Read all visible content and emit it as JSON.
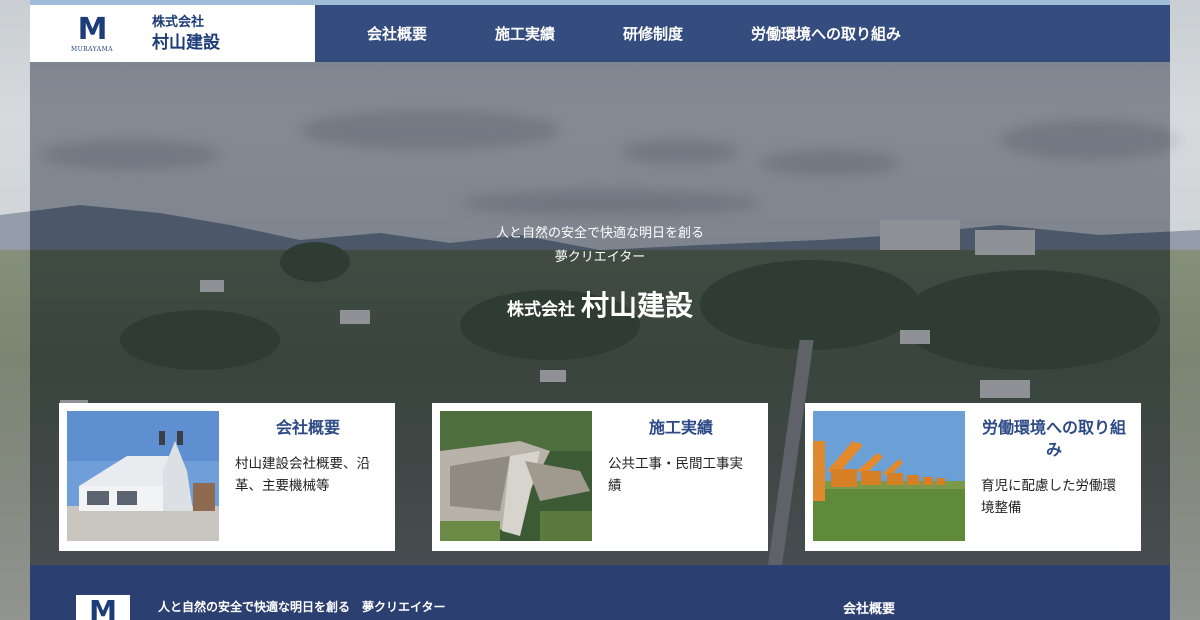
{
  "header": {
    "logo_letter": "M",
    "logo_sub": "MURAYAMA",
    "company_prefix": "株式会社",
    "company_name": "村山建設"
  },
  "nav": {
    "items": [
      {
        "label": "会社概要"
      },
      {
        "label": "施工実績"
      },
      {
        "label": "研修制度"
      },
      {
        "label": "労働環境への取り組み"
      }
    ]
  },
  "hero": {
    "tagline_line1": "人と自然の安全で快適な明日を創る",
    "tagline_line2": "夢クリエイター",
    "title_prefix": "株式会社",
    "title_name": "村山建設"
  },
  "cards": [
    {
      "title": "会社概要",
      "description": "村山建設会社概要、沿革、主要機械等"
    },
    {
      "title": "施工実績",
      "description": "公共工事・民間工事実績"
    },
    {
      "title": "労働環境への取り組み",
      "description": "育児に配慮した労働環境整備"
    }
  ],
  "footer": {
    "logo_letter": "M",
    "tagline": "人と自然の安全で快適な明日を創る　夢クリエイター",
    "link": "会社概要"
  },
  "colors": {
    "brand_blue": "#1d3c78",
    "nav_bg": "#354d7e",
    "footer_bg": "#2b3f70",
    "card_title": "#2c4a86"
  }
}
